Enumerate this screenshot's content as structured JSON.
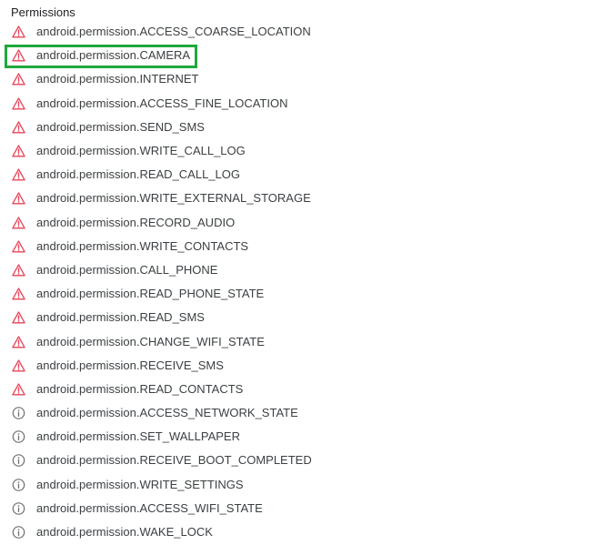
{
  "section": {
    "title": "Permissions"
  },
  "colors": {
    "warning": "#e8455a",
    "info": "#6f6f6f",
    "highlight": "#1fa83a"
  },
  "permissions": [
    {
      "label": "android.permission.ACCESS_COARSE_LOCATION",
      "icon": "warning-icon"
    },
    {
      "label": "android.permission.CAMERA",
      "icon": "warning-icon",
      "highlighted": true
    },
    {
      "label": "android.permission.INTERNET",
      "icon": "warning-icon"
    },
    {
      "label": "android.permission.ACCESS_FINE_LOCATION",
      "icon": "warning-icon"
    },
    {
      "label": "android.permission.SEND_SMS",
      "icon": "warning-icon"
    },
    {
      "label": "android.permission.WRITE_CALL_LOG",
      "icon": "warning-icon"
    },
    {
      "label": "android.permission.READ_CALL_LOG",
      "icon": "warning-icon"
    },
    {
      "label": "android.permission.WRITE_EXTERNAL_STORAGE",
      "icon": "warning-icon"
    },
    {
      "label": "android.permission.RECORD_AUDIO",
      "icon": "warning-icon"
    },
    {
      "label": "android.permission.WRITE_CONTACTS",
      "icon": "warning-icon"
    },
    {
      "label": "android.permission.CALL_PHONE",
      "icon": "warning-icon"
    },
    {
      "label": "android.permission.READ_PHONE_STATE",
      "icon": "warning-icon"
    },
    {
      "label": "android.permission.READ_SMS",
      "icon": "warning-icon"
    },
    {
      "label": "android.permission.CHANGE_WIFI_STATE",
      "icon": "warning-icon"
    },
    {
      "label": "android.permission.RECEIVE_SMS",
      "icon": "warning-icon"
    },
    {
      "label": "android.permission.READ_CONTACTS",
      "icon": "warning-icon"
    },
    {
      "label": "android.permission.ACCESS_NETWORK_STATE",
      "icon": "info-icon"
    },
    {
      "label": "android.permission.SET_WALLPAPER",
      "icon": "info-icon"
    },
    {
      "label": "android.permission.RECEIVE_BOOT_COMPLETED",
      "icon": "info-icon"
    },
    {
      "label": "android.permission.WRITE_SETTINGS",
      "icon": "info-icon"
    },
    {
      "label": "android.permission.ACCESS_WIFI_STATE",
      "icon": "info-icon"
    },
    {
      "label": "android.permission.WAKE_LOCK",
      "icon": "info-icon"
    }
  ]
}
